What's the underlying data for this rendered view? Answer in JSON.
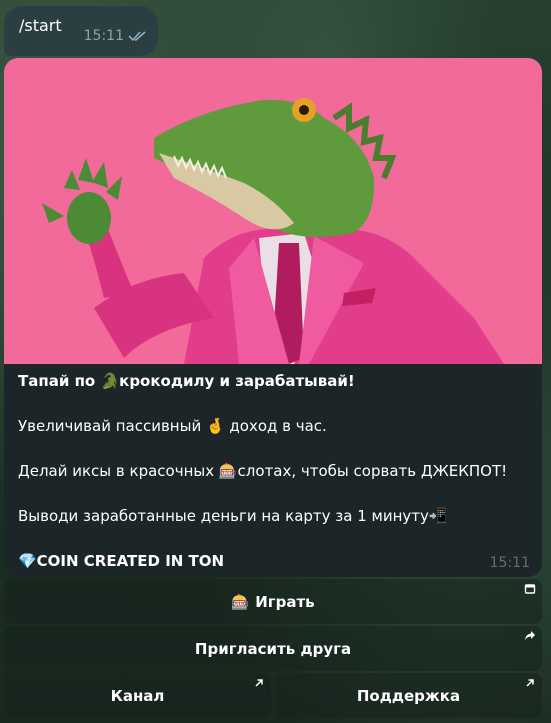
{
  "outgoing": {
    "text": "/start",
    "time": "15:11"
  },
  "message": {
    "headline": "Тапай по 🐊крокодилу и зарабатывай!",
    "line1": "Увеличивай пассивный 🤞 доход в час.",
    "line2": "Делай иксы в красочных 🎰слотах, чтобы сорвать ДЖЕКПОТ!",
    "line3": "Выводи заработанные деньги на карту за 1 минуту📲",
    "line4": "💎COIN CREATED IN TON",
    "time": "15:11"
  },
  "buttons": {
    "play": "🎰 Играть",
    "invite": "Пригласить друга",
    "channel": "Канал",
    "support": "Поддержка"
  },
  "colors": {
    "photo_bg": "#f26a9a",
    "suit": "#e23d8a",
    "croc": "#5f9a3c"
  }
}
